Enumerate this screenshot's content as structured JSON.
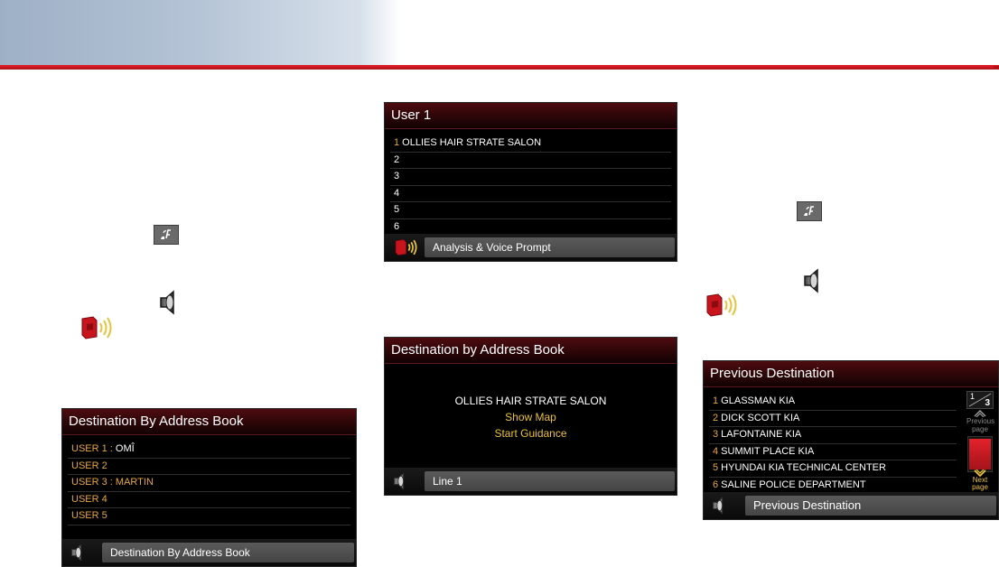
{
  "screens": {
    "user1": {
      "title": "User 1",
      "rows": [
        {
          "num": "1",
          "text": " OLLIES HAIR STRATE SALON"
        },
        {
          "num": "2",
          "text": ""
        },
        {
          "num": "3",
          "text": ""
        },
        {
          "num": "4",
          "text": ""
        },
        {
          "num": "5",
          "text": ""
        },
        {
          "num": "6",
          "text": ""
        }
      ],
      "status_label": "Analysis & Voice Prompt",
      "status_icon": "voice-prompt-icon"
    },
    "dest_addr_book_detail": {
      "title": "Destination by Address Book",
      "name": "OLLIES HAIR STRATE SALON",
      "options": [
        "Show Map",
        "Start Guidance"
      ],
      "status_label": "Line 1",
      "status_icon": "speaker-icon"
    },
    "dest_addr_book_list": {
      "title": "Destination By Address Book",
      "rows": [
        {
          "label": "USER 1",
          "sep": " : ",
          "value": "OMÎ"
        },
        {
          "label": "USER 2",
          "sep": "",
          "value": ""
        },
        {
          "label": "USER 3",
          "sep": " : ",
          "value": "MARTIN"
        },
        {
          "label": "USER 4",
          "sep": "",
          "value": ""
        },
        {
          "label": "USER 5",
          "sep": "",
          "value": ""
        },
        {
          "label": "",
          "sep": "",
          "value": ""
        }
      ],
      "status_label": "Destination By Address Book",
      "status_icon": "speaker-icon"
    },
    "previous_destination": {
      "title": "Previous Destination",
      "rows": [
        {
          "num": "1",
          "text": " GLASSMAN KIA"
        },
        {
          "num": "2",
          "text": " DICK SCOTT KIA"
        },
        {
          "num": "3",
          "text": " LAFONTAINE KIA"
        },
        {
          "num": "4",
          "text": " SUMMIT PLACE KIA"
        },
        {
          "num": "5",
          "text": " HYUNDAI KIA TECHNICAL CENTER"
        },
        {
          "num": "6",
          "text": " SALINE POLICE DEPARTMENT"
        }
      ],
      "page_current": "1",
      "page_total": "3",
      "prev_page_label": [
        "Previous",
        "page"
      ],
      "next_page_label": [
        "Next",
        "page"
      ],
      "status_label": "Previous Destination",
      "status_icon": "speaker-icon"
    }
  },
  "colors": {
    "accent_red": "#c8141c",
    "orange_text": "#e8a73c",
    "yellow_text": "#e9c23a",
    "banner_blue": "#9eb0c6"
  }
}
